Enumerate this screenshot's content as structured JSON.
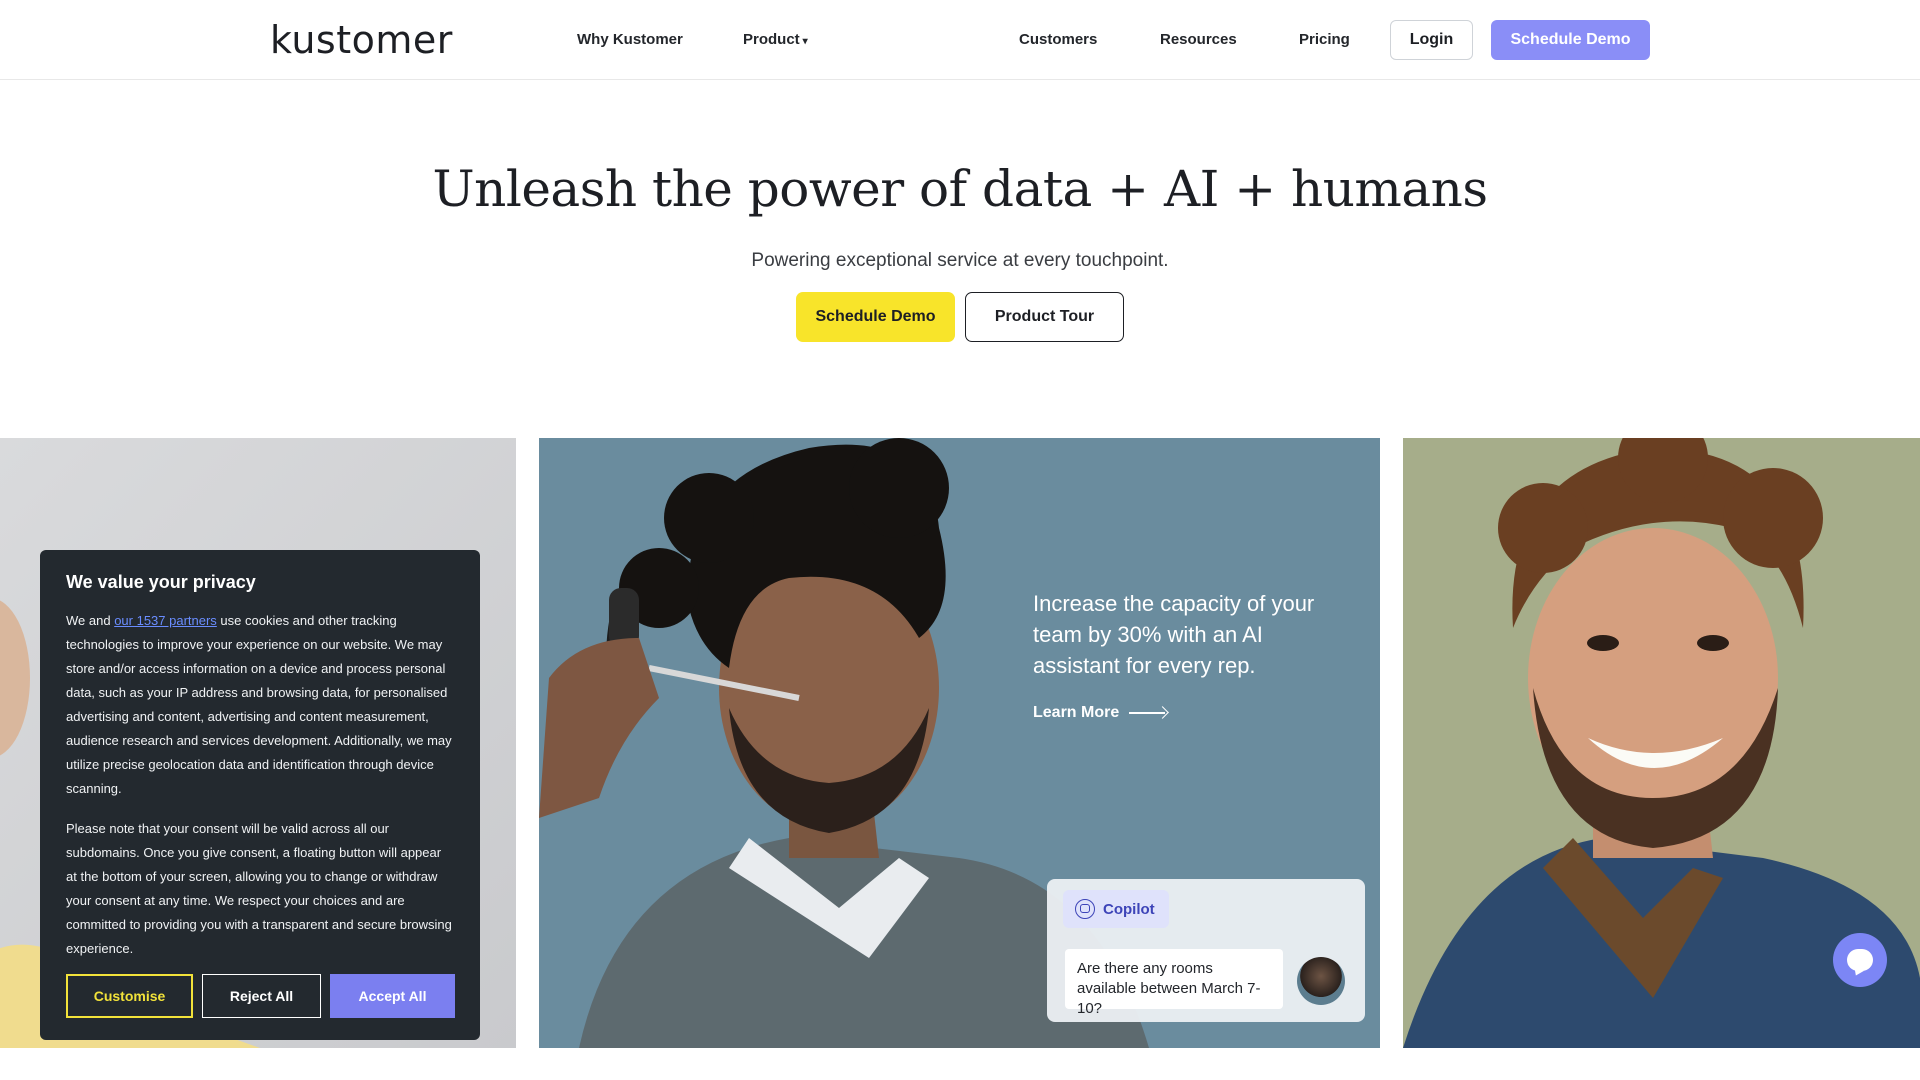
{
  "header": {
    "logo": "kustomer",
    "nav": {
      "why": "Why Kustomer",
      "product": "Product",
      "customers": "Customers",
      "resources": "Resources",
      "pricing": "Pricing"
    },
    "login": "Login",
    "schedule_demo": "Schedule Demo"
  },
  "hero": {
    "title": "Unleash the power of data + AI + humans",
    "subtitle": "Powering exceptional service at every touchpoint.",
    "primary_button": "Schedule Demo",
    "secondary_button": "Product Tour"
  },
  "promo": {
    "text": "Increase the capacity of your team by 30% with an AI assistant for every rep.",
    "learn_more": "Learn More",
    "copilot_label": "Copilot",
    "chat_message": "Are there any rooms available between March 7-10?"
  },
  "cookie": {
    "title": "We value your privacy",
    "body1_prefix": "We and ",
    "body1_link": "our 1537 partners",
    "body1_suffix": " use cookies and other tracking technologies to improve your experience on our website. We may store and/or access information on a device and process personal data, such as your IP address and browsing data, for personalised advertising and content, advertising and content measurement, audience research and services development. Additionally, we may utilize precise geolocation data and identification through device scanning.",
    "body2": "Please note that your consent will be valid across all our subdomains. Once you give consent, a floating button will appear at the bottom of your screen, allowing you to change or withdraw your consent at any time. We respect your choices and are committed to providing you with a transparent and secure browsing experience.",
    "customise": "Customise",
    "reject": "Reject All",
    "accept": "Accept All"
  },
  "colors": {
    "accent": "#8a8ef7",
    "hero_button": "#f8e42a",
    "cookie_bg": "#23292f",
    "promo_bg": "#6a8c9e"
  }
}
